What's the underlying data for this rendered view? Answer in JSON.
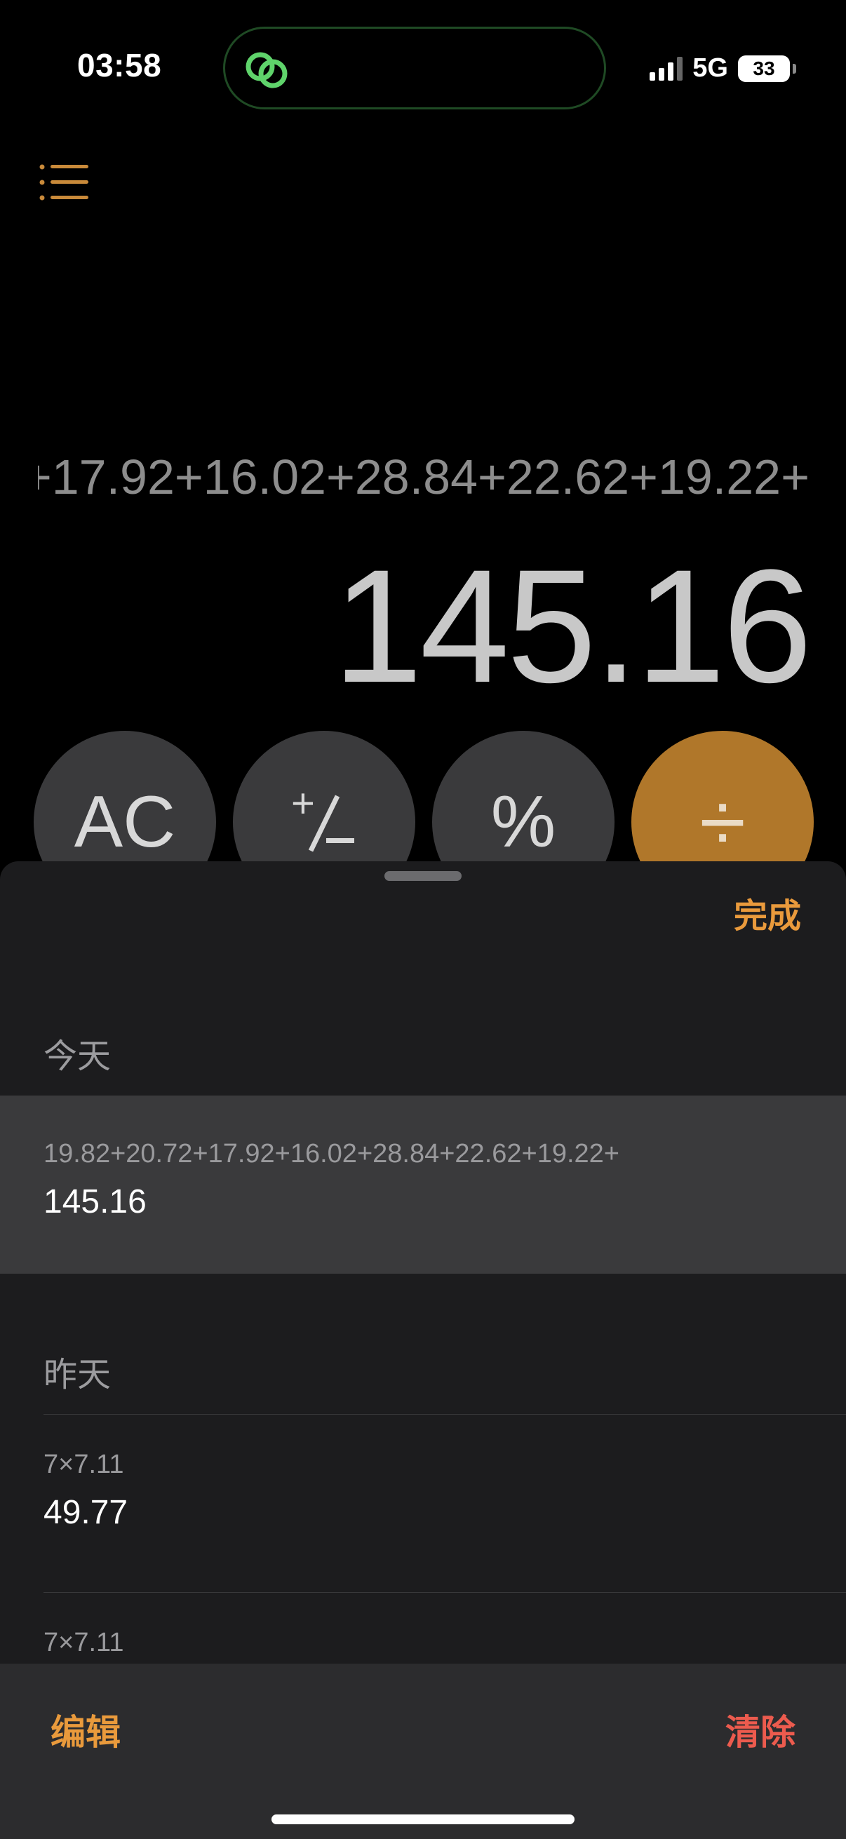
{
  "status": {
    "time": "03:58",
    "network": "5G",
    "battery": "33"
  },
  "icons": {
    "menu": "list-icon",
    "island": "link-icon"
  },
  "display": {
    "expression": "19.82+20.72+17.92+16.02+28.84+22.62+19.22+",
    "result": "145.16"
  },
  "keypad": {
    "ac": "AC",
    "plus_minus": "+/-",
    "percent": "%",
    "divide": "÷"
  },
  "history": {
    "done_label": "完成",
    "sections": [
      {
        "title": "今天",
        "items": [
          {
            "expression": "19.82+20.72+17.92+16.02+28.84+22.62+19.22+",
            "result": "145.16"
          }
        ]
      },
      {
        "title": "昨天",
        "items": [
          {
            "expression": "7×7.11",
            "result": "49.77"
          },
          {
            "expression": "7×7.11",
            "result": ""
          }
        ]
      }
    ],
    "edit_label": "编辑",
    "clear_label": "清除"
  },
  "colors": {
    "accent": "#e99a3c",
    "operator_key": "#b0772a",
    "destructive": "#ec5b4e",
    "sheet_bg": "#1c1c1e",
    "selected_row": "#3a3a3c"
  }
}
